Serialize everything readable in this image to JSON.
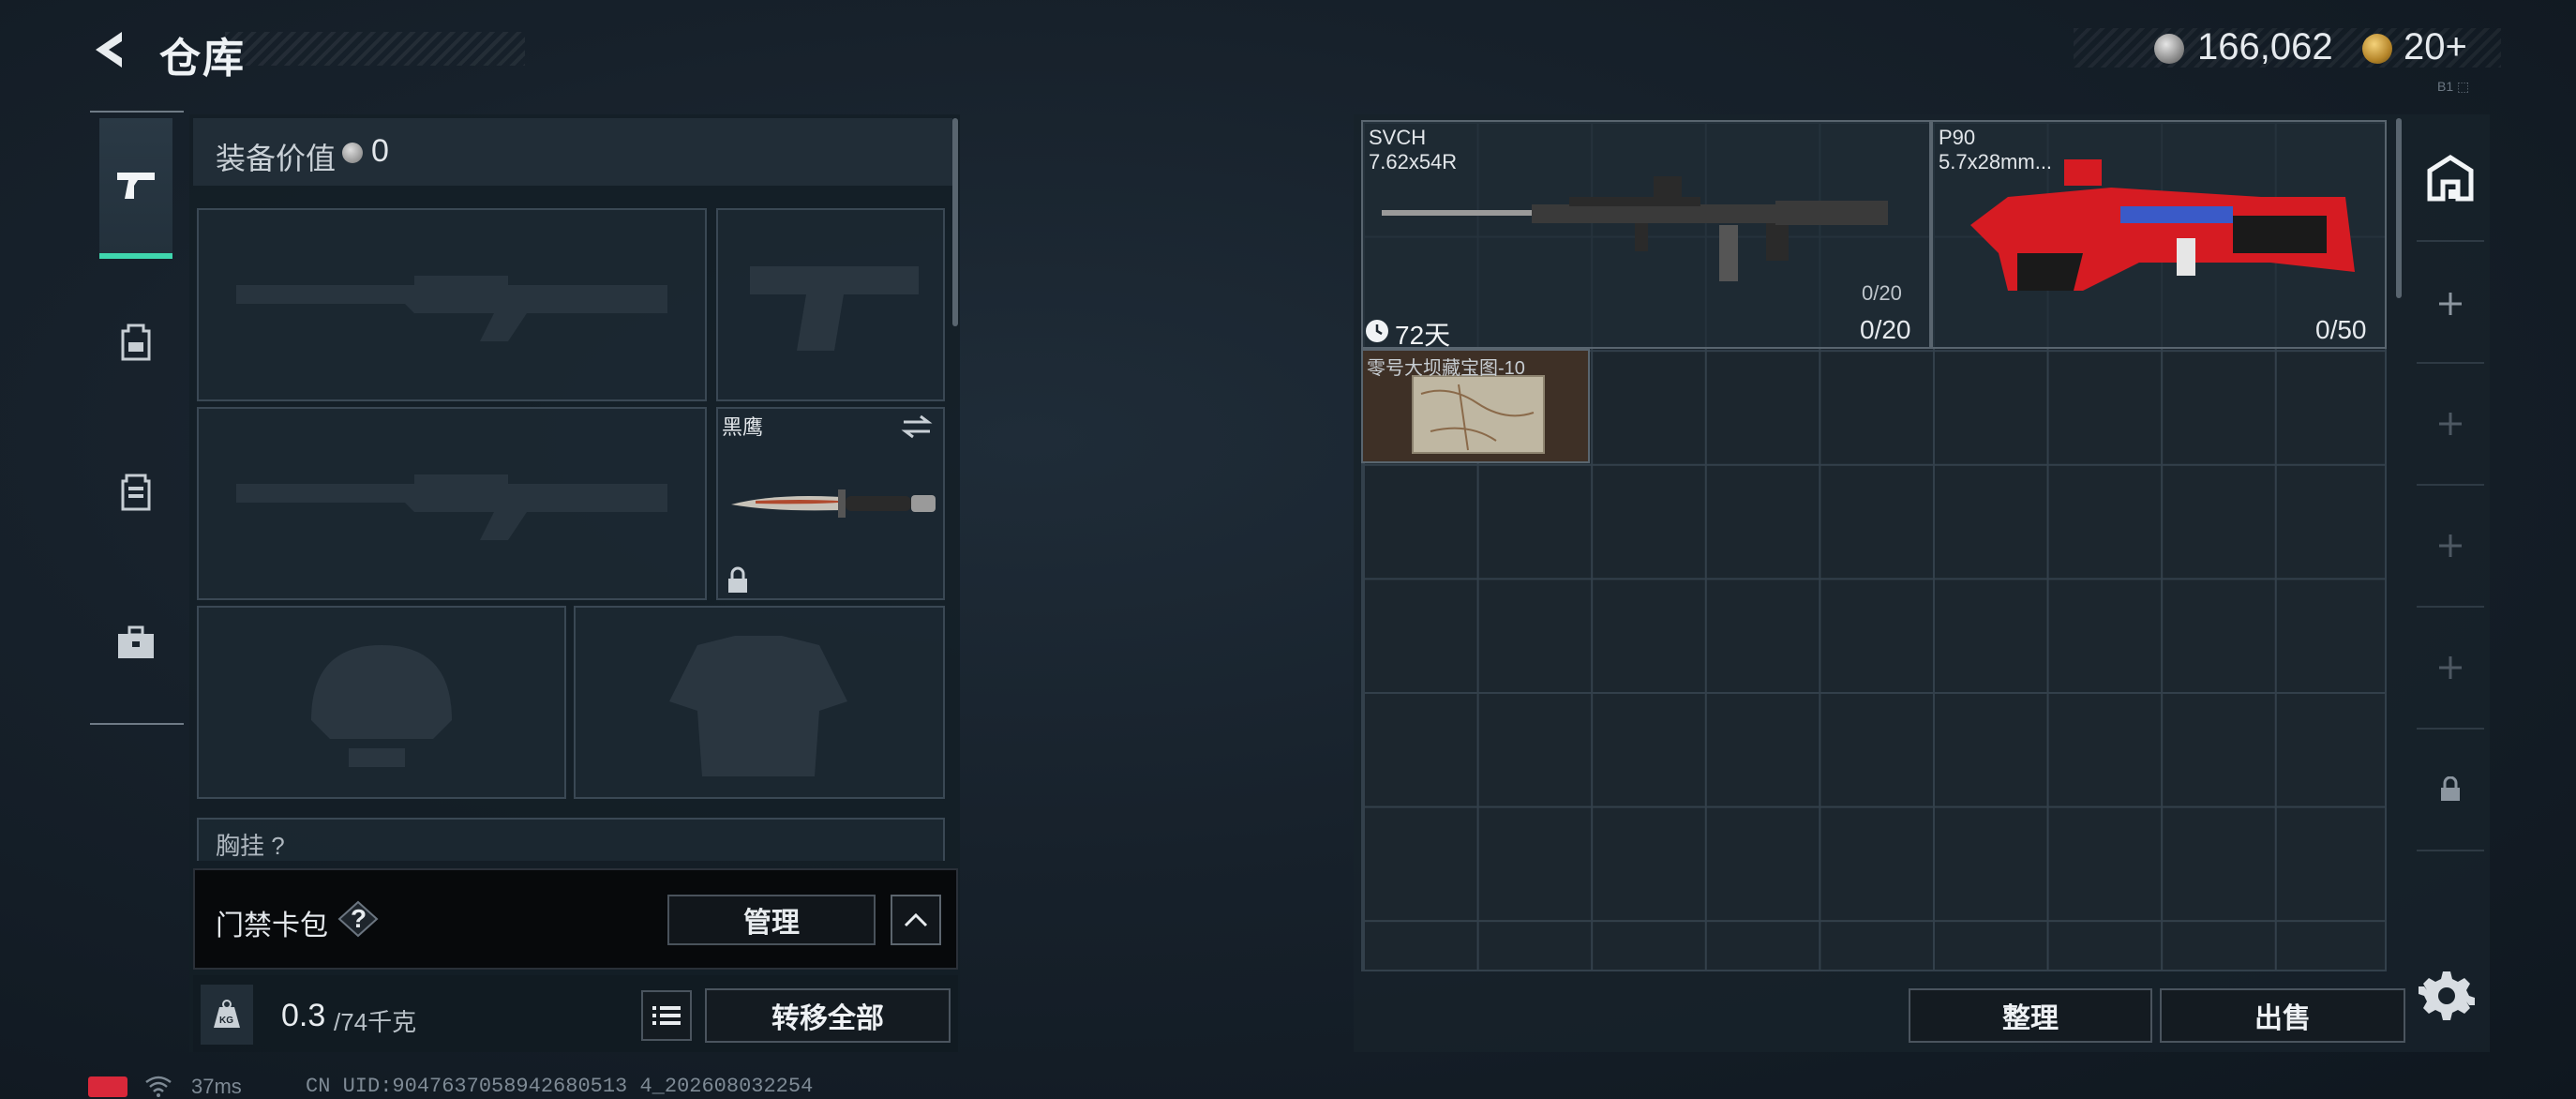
{
  "header": {
    "title": "仓库",
    "currency_silver": "166,062",
    "currency_gold": "20+",
    "mini_status": "B1 ⬚"
  },
  "nav": {
    "items": [
      {
        "icon": "pistol-icon",
        "active": true
      },
      {
        "icon": "backpack-icon",
        "active": false
      },
      {
        "icon": "vest-icon",
        "active": false
      },
      {
        "icon": "case-icon",
        "active": false
      }
    ]
  },
  "equipment": {
    "value_label": "装备价值",
    "value": "0",
    "knife_name": "黑鹰",
    "chest_label": "胸挂 ?",
    "card_label": "门禁卡包",
    "help_symbol": "?",
    "manage_label": "管理",
    "weight_value": "0.3",
    "weight_max": "/74千克",
    "transfer_label": "转移全部"
  },
  "status": {
    "ping": "37ms",
    "uid": "CN UID:9047637058942680513 4_202608032254"
  },
  "storage": {
    "items": [
      {
        "name": "SVCH",
        "caliber": "7.62x54R",
        "ammo_small": "0/20",
        "ammo": "0/20",
        "timer": "72天"
      },
      {
        "name": "P90",
        "caliber": "5.7x28mm...",
        "ammo": "0/50"
      },
      {
        "name": "零号大坝藏宝图-10"
      }
    ],
    "sort_label": "整理",
    "sell_label": "出售"
  },
  "colors": {
    "accent": "#3fd6ae",
    "panel": "#1c262e",
    "danger": "#d9283a"
  }
}
